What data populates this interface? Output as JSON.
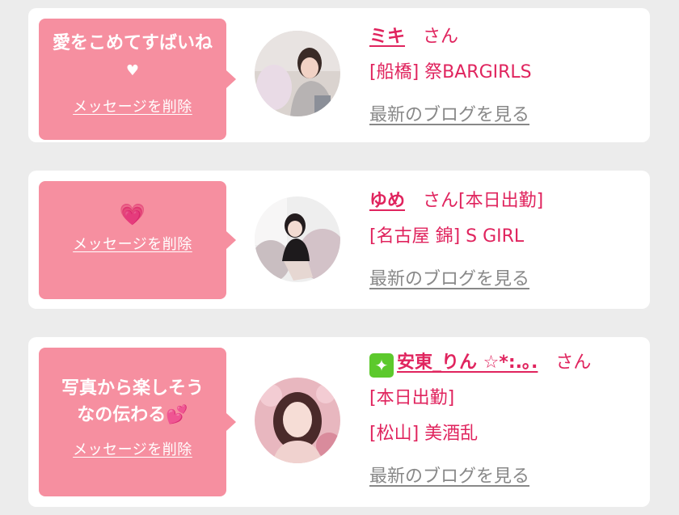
{
  "items": [
    {
      "message": "愛をこめてすばいね",
      "message_icon": "heart-icon",
      "delete_label": "メッセージを削除",
      "name": "ミキ",
      "honorific": "さん",
      "status": "",
      "shop": "[船橋] 祭BARGIRLS",
      "blog_label": "最新のブログを見る"
    },
    {
      "message": "",
      "message_icon": "sparkling-heart-icon",
      "delete_label": "メッセージを削除",
      "name": "ゆめ",
      "honorific": "さん",
      "status": "[本日出勤]",
      "shop": "[名古屋 錦] S GIRL",
      "blog_label": "最新のブログを見る"
    },
    {
      "message_line1": "写真から楽しそう",
      "message_line2": "なの伝わる",
      "message_icon": "two-hearts-icon",
      "delete_label": "メッセージを削除",
      "name_icon": "sparkle-icon",
      "name": "安東_りん ☆*:.｡.",
      "honorific": "さん",
      "status": "[本日出勤]",
      "shop": "[松山] 美酒乱",
      "blog_label": "最新のブログを見る"
    }
  ],
  "colors": {
    "accent": "#e0245e",
    "bubble": "#f68fa0",
    "link_gray": "#888888",
    "background": "#ececec"
  }
}
